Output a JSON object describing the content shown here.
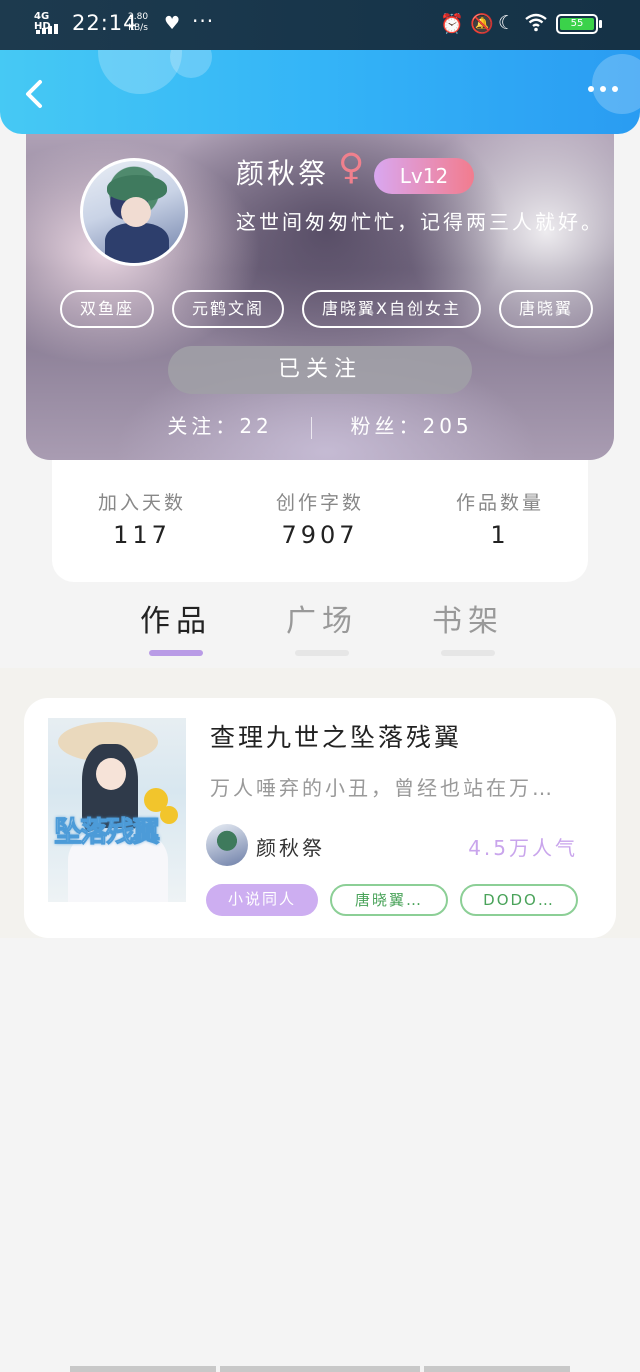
{
  "status_bar": {
    "network": "4G HD",
    "time": "22:14",
    "speed_value": "2.80",
    "speed_unit": "KB/s",
    "battery": "55",
    "icons": [
      "alarm-icon",
      "mute-icon",
      "moon-icon",
      "wifi-icon",
      "battery-icon"
    ]
  },
  "header": {
    "back_icon": "chevron-left-icon",
    "more_icon": "more-dots-icon"
  },
  "profile": {
    "name": "颜秋祭",
    "gender_symbol": "♀",
    "level": "Lv12",
    "bio": "这世间匆匆忙忙，记得两三人就好。",
    "tags": [
      "双鱼座",
      "元鹤文阁",
      "唐晓翼X自创女主",
      "唐晓翼"
    ],
    "follow_button": "已关注",
    "following_label": "关注：",
    "following_count": "22",
    "fans_label": "粉丝：",
    "fans_count": "205"
  },
  "stats": [
    {
      "label": "加入天数",
      "value": "117"
    },
    {
      "label": "创作字数",
      "value": "7907"
    },
    {
      "label": "作品数量",
      "value": "1"
    }
  ],
  "tabs": [
    {
      "label": "作品",
      "active": true
    },
    {
      "label": "广场",
      "active": false
    },
    {
      "label": "书架",
      "active": false
    }
  ],
  "works": [
    {
      "cover_title": "坠落残翼",
      "title": "查理九世之坠落残翼",
      "description": "万人唾弃的小丑，曾经也站在万…",
      "author": "颜秋祭",
      "popularity": "4.5万人气",
      "tags": [
        "小说同人",
        "唐晓翼…",
        "DODO…"
      ]
    }
  ],
  "colors": {
    "header_blue": "#34b4f7",
    "accent_purple": "#b99be6",
    "tag_green": "#8ccf96",
    "popularity": "#c9a5ec",
    "level_gradient": [
      "#d9a7f0",
      "#f27c8e"
    ]
  }
}
